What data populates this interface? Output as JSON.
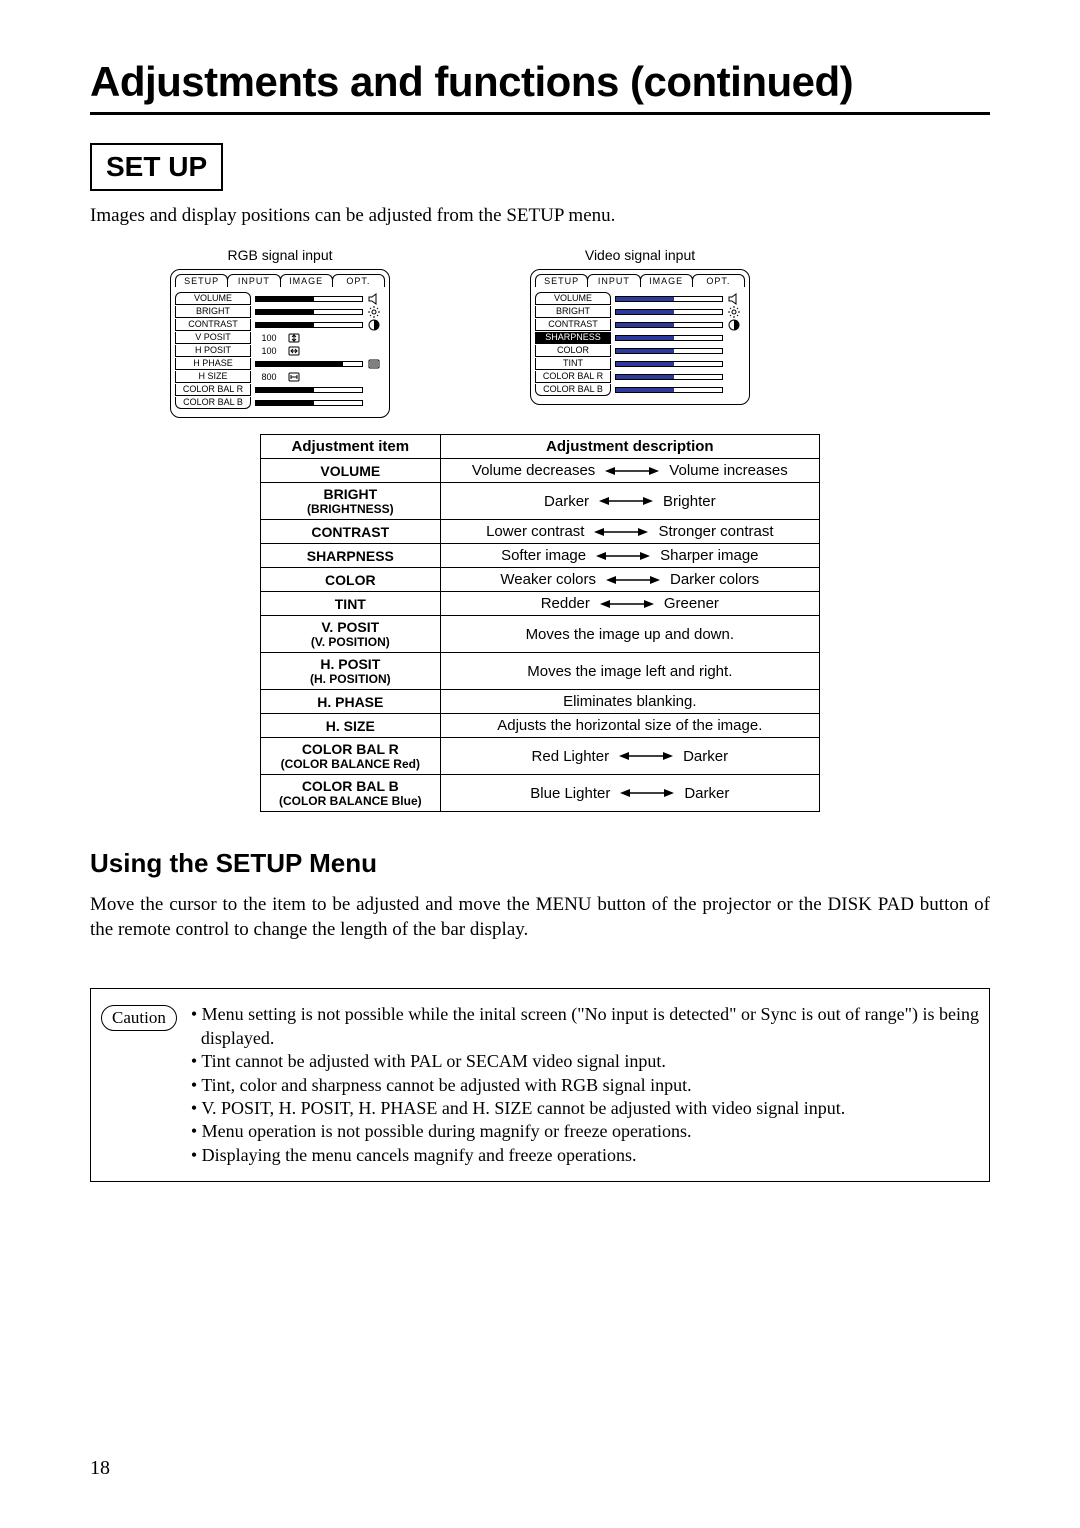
{
  "pageNumber": "18",
  "title": "Adjustments and functions (continued)",
  "section": "SET UP",
  "intro": "Images and display positions can be adjusted from the SETUP menu.",
  "using_head": "Using the SETUP Menu",
  "using_para": "Move the cursor to the item to be adjusted and move the MENU button of the projector or the DISK PAD button of the remote control to change the length of the bar display.",
  "caution_label": "Caution",
  "caution_items": [
    "• Menu setting is not possible while the inital screen (\"No input is detected\" or Sync is out of range\") is being displayed.",
    "• Tint cannot be adjusted with PAL or SECAM video signal input.",
    "• Tint, color and sharpness cannot be adjusted with RGB signal input.",
    "• V. POSIT, H. POSIT, H. PHASE and H. SIZE cannot be adjusted with video signal input.",
    "• Menu operation is not possible during magnify or freeze operations.",
    "• Displaying the menu cancels magnify and freeze operations."
  ],
  "menu_tabs": [
    "SETUP",
    "INPUT",
    "IMAGE",
    "OPT."
  ],
  "rgb_caption": "RGB signal input",
  "video_caption": "Video signal input",
  "rgb_items": [
    {
      "l": "VOLUME",
      "fill": 0.55,
      "val": "",
      "icon": "speaker",
      "hl": false,
      "cls": "first",
      "color": "k"
    },
    {
      "l": "BRIGHT",
      "fill": 0.55,
      "val": "",
      "icon": "sun",
      "hl": false,
      "cls": "",
      "color": "k"
    },
    {
      "l": "CONTRAST",
      "fill": 0.55,
      "val": "",
      "icon": "contrast",
      "hl": false,
      "cls": "",
      "color": "k"
    },
    {
      "l": "V  POSIT",
      "fill": 0,
      "val": "100",
      "icon": "vpos",
      "hl": false,
      "cls": "",
      "color": "k"
    },
    {
      "l": "H  POSIT",
      "fill": 0,
      "val": "100",
      "icon": "hpos",
      "hl": false,
      "cls": "",
      "color": "k"
    },
    {
      "l": "H  PHASE",
      "fill": 0.82,
      "val": "",
      "icon": "phase",
      "hl": false,
      "cls": "",
      "color": "k"
    },
    {
      "l": "H  SIZE",
      "fill": 0,
      "val": "800",
      "icon": "hsize",
      "hl": false,
      "cls": "",
      "color": "k"
    },
    {
      "l": "COLOR BAL  R",
      "fill": 0.55,
      "val": "",
      "icon": "",
      "hl": false,
      "cls": "",
      "color": "k"
    },
    {
      "l": "COLOR BAL  B",
      "fill": 0.55,
      "val": "",
      "icon": "",
      "hl": false,
      "cls": "last",
      "color": "k"
    }
  ],
  "video_items": [
    {
      "l": "VOLUME",
      "fill": 0.55,
      "val": "",
      "icon": "speaker",
      "hl": false,
      "cls": "first",
      "color": "b"
    },
    {
      "l": "BRIGHT",
      "fill": 0.55,
      "val": "",
      "icon": "sun",
      "hl": false,
      "cls": "",
      "color": "b"
    },
    {
      "l": "CONTRAST",
      "fill": 0.55,
      "val": "",
      "icon": "contrast",
      "hl": false,
      "cls": "",
      "color": "b"
    },
    {
      "l": "SHARPNESS",
      "fill": 0.55,
      "val": "",
      "icon": "",
      "hl": true,
      "cls": "",
      "color": "b"
    },
    {
      "l": "COLOR",
      "fill": 0.55,
      "val": "",
      "icon": "",
      "hl": false,
      "cls": "",
      "color": "b"
    },
    {
      "l": "TINT",
      "fill": 0.55,
      "val": "",
      "icon": "",
      "hl": false,
      "cls": "",
      "color": "b"
    },
    {
      "l": "COLOR  BAL  R",
      "fill": 0.55,
      "val": "",
      "icon": "",
      "hl": false,
      "cls": "",
      "color": "b"
    },
    {
      "l": "COLOR  BAL  B",
      "fill": 0.55,
      "val": "",
      "icon": "",
      "hl": false,
      "cls": "last",
      "color": "b"
    }
  ],
  "adj_header": {
    "a": "Adjustment item",
    "b": "Adjustment description"
  },
  "adj_rows": [
    {
      "name": "VOLUME",
      "sub": "",
      "type": "lr",
      "l": "Volume decreases",
      "r": "Volume increases"
    },
    {
      "name": "BRIGHT",
      "sub": "(BRIGHTNESS)",
      "type": "lr",
      "l": "Darker",
      "r": "Brighter"
    },
    {
      "name": "CONTRAST",
      "sub": "",
      "type": "lr",
      "l": "Lower contrast",
      "r": "Stronger contrast"
    },
    {
      "name": "SHARPNESS",
      "sub": "",
      "type": "lr",
      "l": "Softer image",
      "r": "Sharper image"
    },
    {
      "name": "COLOR",
      "sub": "",
      "type": "lr",
      "l": "Weaker colors",
      "r": "Darker colors"
    },
    {
      "name": "TINT",
      "sub": "",
      "type": "lr",
      "l": "Redder",
      "r": "Greener"
    },
    {
      "name": "V. POSIT",
      "sub": "(V. POSITION)",
      "type": "txt",
      "t": "Moves the image up and down."
    },
    {
      "name": "H. POSIT",
      "sub": "(H. POSITION)",
      "type": "txt",
      "t": "Moves the image left and right."
    },
    {
      "name": "H. PHASE",
      "sub": "",
      "type": "txt",
      "t": "Eliminates blanking."
    },
    {
      "name": "H. SIZE",
      "sub": "",
      "type": "txt",
      "t": "Adjusts the horizontal size of the image."
    },
    {
      "name": "COLOR BAL  R",
      "sub": "(COLOR BALANCE Red)",
      "type": "lr",
      "l": "Red   Lighter",
      "r": "Darker"
    },
    {
      "name": "COLOR BAL  B",
      "sub": "(COLOR BALANCE Blue)",
      "type": "lr",
      "l": "Blue   Lighter",
      "r": "Darker"
    }
  ]
}
